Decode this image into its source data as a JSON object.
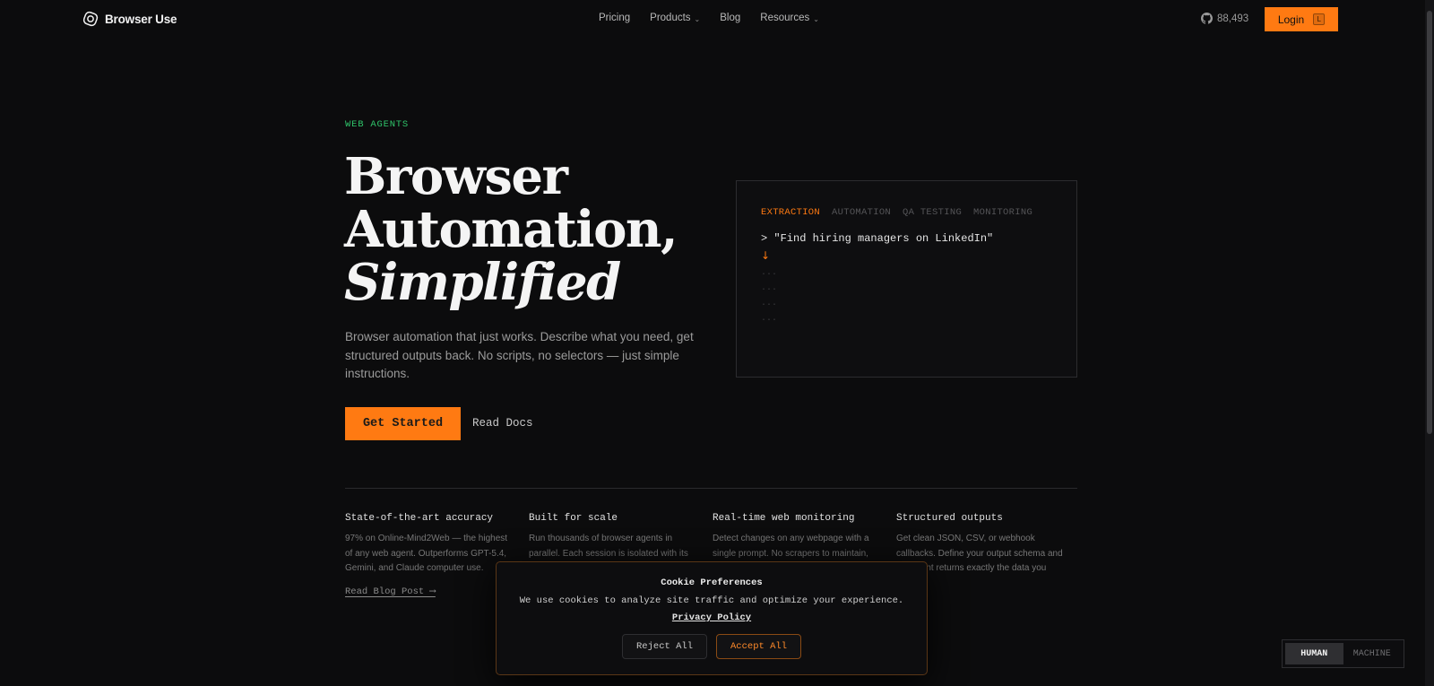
{
  "header": {
    "brand": "Browser Use",
    "nav": [
      {
        "label": "Pricing",
        "dropdown": false
      },
      {
        "label": "Products",
        "dropdown": true
      },
      {
        "label": "Blog",
        "dropdown": false
      },
      {
        "label": "Resources",
        "dropdown": true
      }
    ],
    "github_stars": "88,493",
    "login_label": "Login",
    "login_shortcut": "L"
  },
  "hero": {
    "eyebrow": "WEB AGENTS",
    "title_line1": "Browser",
    "title_line2": "Automation,",
    "title_line3": "Simplified",
    "description": "Browser automation that just works. Describe what you need, get structured outputs back. No scripts, no selectors — just simple instructions.",
    "primary_cta": "Get Started",
    "secondary_cta": "Read Docs"
  },
  "terminal": {
    "tabs": [
      "EXTRACTION",
      "AUTOMATION",
      "QA TESTING",
      "MONITORING"
    ],
    "active_tab": "EXTRACTION",
    "prompt": "> \"Find hiring managers on LinkedIn\"",
    "arrow": "↓",
    "placeholder_lines": [
      "...",
      "...",
      "...",
      "..."
    ]
  },
  "features": [
    {
      "title": "State-of-the-art accuracy",
      "description": "97% on Online-Mind2Web — the highest of any web agent. Outperforms GPT-5.4, Gemini, and Claude computer use.",
      "link": "Read Blog Post ⟶"
    },
    {
      "title": "Built for scale",
      "description": "Run thousands of browser agents in parallel. Each session is isolated with its",
      "link": ""
    },
    {
      "title": "Real-time web monitoring",
      "description": "Detect changes on any webpage with a single prompt. No scrapers to maintain,",
      "link": ""
    },
    {
      "title": "Structured outputs",
      "description": "Get clean JSON, CSV, or webhook callbacks. Define your output schema and the agent returns exactly the data you need.",
      "link": ""
    }
  ],
  "cookie": {
    "title": "Cookie Preferences",
    "text": "We use cookies to analyze site traffic and optimize your experience.",
    "link": "Privacy Policy",
    "reject": "Reject All",
    "accept": "Accept All"
  },
  "mode_toggle": {
    "human": "HUMAN",
    "machine": "MACHINE",
    "active": "HUMAN"
  },
  "colors": {
    "accent": "#ff7a12",
    "eyebrow": "#2fc46a",
    "background": "#0c0c0d"
  }
}
